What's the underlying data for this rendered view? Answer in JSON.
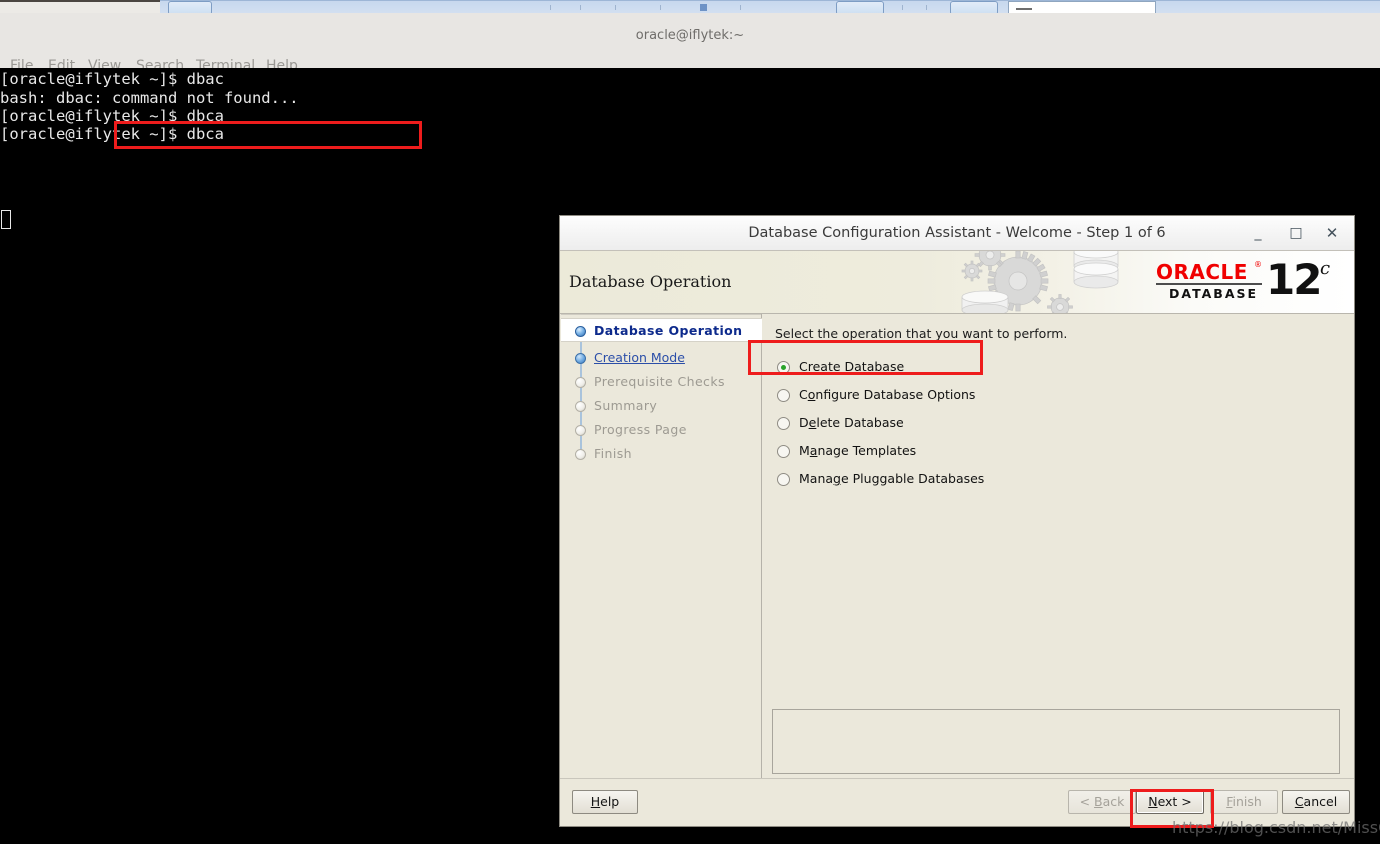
{
  "desktop": {
    "top_toolbar": {
      "note": ""
    }
  },
  "terminal": {
    "title": "oracle@iflytek:~",
    "menu": [
      "File",
      "Edit",
      "View",
      "Search",
      "Terminal",
      "Help"
    ],
    "lines": [
      "[oracle@iflytek ~]$ dbac",
      "bash: dbac: command not found...",
      "[oracle@iflytek ~]$ dbca",
      "[oracle@iflytek ~]$ dbca"
    ]
  },
  "dialog": {
    "title": "Database Configuration Assistant - Welcome - Step 1 of 6",
    "window_controls": {
      "minimize": "_",
      "maximize": "□",
      "close": "✕"
    },
    "header": {
      "title": "Database Operation",
      "logo": {
        "brand": "ORACLE",
        "registered": "®",
        "product": "DATABASE",
        "version": "12",
        "edition": "c"
      }
    },
    "nav": {
      "items": [
        {
          "label": "Database Operation",
          "state": "current"
        },
        {
          "label": "Creation Mode",
          "state": "visited"
        },
        {
          "label": "Prerequisite Checks",
          "state": "disabled"
        },
        {
          "label": "Summary",
          "state": "disabled"
        },
        {
          "label": "Progress Page",
          "state": "disabled"
        },
        {
          "label": "Finish",
          "state": "disabled"
        }
      ]
    },
    "pane": {
      "instruction": "Select the operation that you want to perform.",
      "options": [
        {
          "label_pre": "C",
          "mnemonic": "r",
          "label_post": "eate Database",
          "selected": true
        },
        {
          "label_pre": "C",
          "mnemonic": "o",
          "label_post": "nfigure Database Options",
          "selected": false
        },
        {
          "label_pre": "D",
          "mnemonic": "e",
          "label_post": "lete Database",
          "selected": false
        },
        {
          "label_pre": "M",
          "mnemonic": "a",
          "label_post": "nage Templates",
          "selected": false
        },
        {
          "label_pre": "Mana",
          "mnemonic": "g",
          "label_post": "e Pluggable Databases",
          "selected": false
        }
      ],
      "message_box_text": ""
    },
    "footer": {
      "help": {
        "pre": "",
        "mnemonic": "H",
        "post": "elp",
        "disabled": false
      },
      "back": {
        "pre": "< ",
        "mnemonic": "B",
        "post": "ack",
        "disabled": true
      },
      "next": {
        "pre": "",
        "mnemonic": "N",
        "post": "ext >",
        "disabled": false
      },
      "finish": {
        "pre": "",
        "mnemonic": "F",
        "post": "inish",
        "disabled": true
      },
      "cancel": {
        "pre": "",
        "mnemonic": "C",
        "post": "ancel",
        "disabled": false
      }
    }
  },
  "annotations": {
    "terminal_command_box": "dbca",
    "create_database_box": "Create Database",
    "next_button_box": "Next >"
  },
  "watermark": "https://blog.csdn.net/MissGuo",
  "colors": {
    "accent_red": "#ee1c1c",
    "oracle_red": "#f00000",
    "dialog_bg": "#ebe8db",
    "terminal_bg": "#000000",
    "nav_link": "#2b4ea8"
  }
}
